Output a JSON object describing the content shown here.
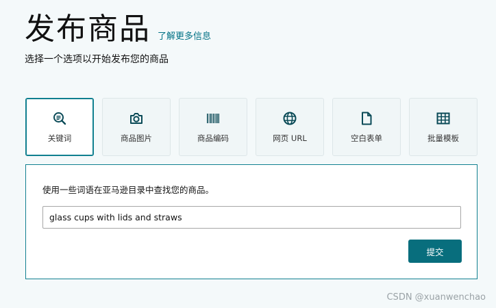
{
  "header": {
    "title": "发布商品",
    "learn_more": "了解更多信息",
    "subtitle": "选择一个选项以开始发布您的商品"
  },
  "tabs": [
    {
      "label": "关键词",
      "icon": "keyword-search-icon",
      "active": true
    },
    {
      "label": "商品图片",
      "icon": "camera-icon",
      "active": false
    },
    {
      "label": "商品编码",
      "icon": "barcode-icon",
      "active": false
    },
    {
      "label": "网页 URL",
      "icon": "globe-icon",
      "active": false
    },
    {
      "label": "空白表单",
      "icon": "document-icon",
      "active": false
    },
    {
      "label": "批量模板",
      "icon": "spreadsheet-icon",
      "active": false
    }
  ],
  "panel": {
    "instruction": "使用一些词语在亚马逊目录中查找您的商品。",
    "search_value": "glass cups with lids and straws",
    "submit_label": "提交"
  },
  "watermark": "CSDN @xuanwenchao",
  "colors": {
    "accent": "#0f7f8f",
    "button": "#086e7d",
    "link": "#007185",
    "background": "#f4f9fa"
  }
}
